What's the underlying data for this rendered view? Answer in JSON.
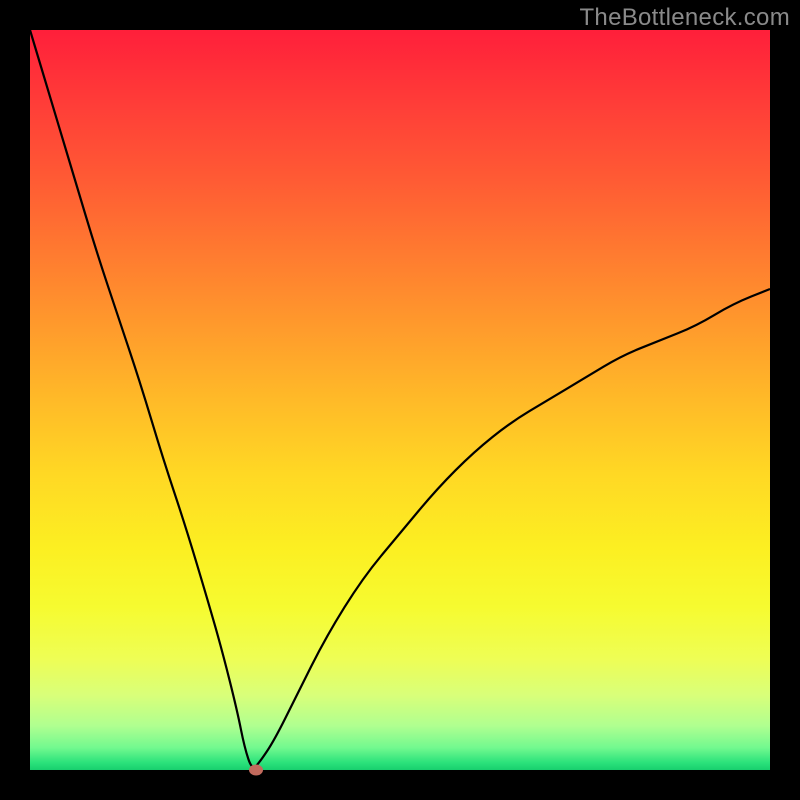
{
  "watermark": "TheBottleneck.com",
  "colors": {
    "frame": "#000000",
    "curve": "#000000",
    "marker": "#c26a5d"
  },
  "chart_data": {
    "type": "line",
    "title": "",
    "xlabel": "",
    "ylabel": "",
    "xlim": [
      0,
      100
    ],
    "ylim": [
      0,
      100
    ],
    "grid": false,
    "background": "gradient-red-yellow-green",
    "note": "x is a parameter swept 0–100; y is bottleneck % (0 = balanced/green, 100 = severe/red). Curve has a V-shaped minimum near x≈30 where y≈0, rises steeply to the left (y→100 at x=0) and logarithmically to the right (y≈65 at x=100).",
    "series": [
      {
        "name": "bottleneck-curve",
        "x": [
          0,
          3,
          6,
          9,
          12,
          15,
          18,
          21,
          24,
          26,
          28,
          29,
          30,
          31,
          33,
          36,
          40,
          45,
          50,
          55,
          60,
          65,
          70,
          75,
          80,
          85,
          90,
          95,
          100
        ],
        "y": [
          100,
          90,
          80,
          70,
          61,
          52,
          42,
          33,
          23,
          16,
          8,
          3,
          0,
          1,
          4,
          10,
          18,
          26,
          32,
          38,
          43,
          47,
          50,
          53,
          56,
          58,
          60,
          63,
          65
        ]
      }
    ],
    "marker": {
      "x": 30.5,
      "y": 0
    }
  }
}
